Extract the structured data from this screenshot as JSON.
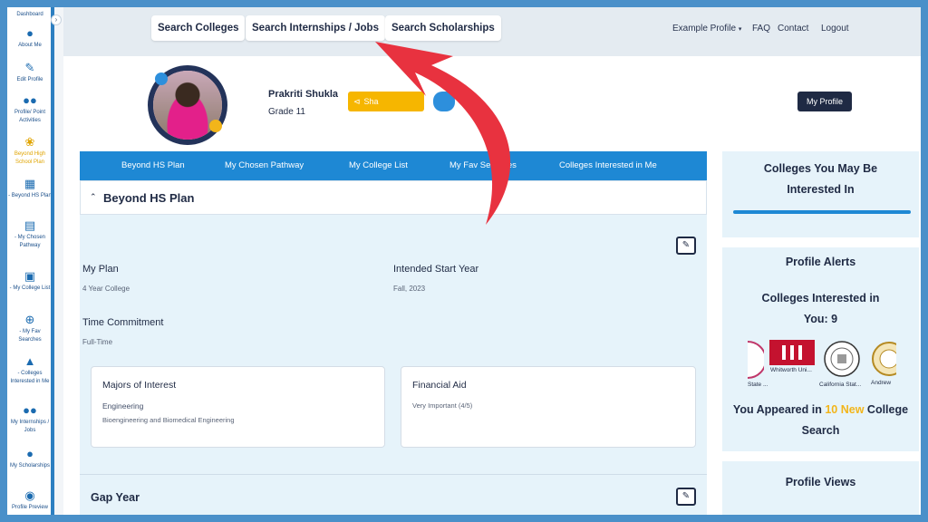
{
  "sidebar": {
    "items": [
      {
        "label": "Dashboard",
        "icon": "dashboard-icon"
      },
      {
        "label": "About Me",
        "icon": "user-icon"
      },
      {
        "label": "Edit Profile",
        "icon": "edit-icon"
      },
      {
        "label": "Profile/ Point Activities",
        "icon": "users-icon"
      },
      {
        "label": "Beyond High School Plan",
        "icon": "feather-icon"
      },
      {
        "label": "- Beyond HS Plan",
        "icon": "document-icon"
      },
      {
        "label": "- My Chosen Pathway",
        "icon": "map-icon"
      },
      {
        "label": "- My College List",
        "icon": "building-icon"
      },
      {
        "label": "- My Fav Searches",
        "icon": "search-plus-icon"
      },
      {
        "label": "- Colleges Interested in Me",
        "icon": "graduation-cap-icon"
      },
      {
        "label": "My Internships / Jobs",
        "icon": "users-icon"
      },
      {
        "label": "My Scholarships",
        "icon": "user-icon"
      },
      {
        "label": "Profile Preview",
        "icon": "eye-icon"
      }
    ]
  },
  "topbar": {
    "search_colleges": "Search Colleges",
    "search_internships": "Search Internships / Jobs",
    "search_scholarships": "Search Scholarships",
    "example_profile": "Example Profile",
    "faq": "FAQ",
    "contact": "Contact",
    "logout": "Logout"
  },
  "profile": {
    "name": "Prakriti Shukla",
    "grade": "Grade 11",
    "share_label": "Sha",
    "my_profile": "My Profile"
  },
  "tabs": [
    "Beyond HS Plan",
    "My Chosen Pathway",
    "My College List",
    "My Fav Searches",
    "Colleges Interested in Me"
  ],
  "beyond_hs_plan": {
    "title": "Beyond HS Plan",
    "my_plan_label": "My Plan",
    "my_plan_value": "4 Year College",
    "start_year_label": "Intended Start Year",
    "start_year_value": "Fall, 2023",
    "time_commitment_label": "Time Commitment",
    "time_commitment_value": "Full-Time",
    "majors_title": "Majors of Interest",
    "majors_category": "Engineering",
    "majors_detail": "Bioengineering and Biomedical Engineering",
    "financial_aid_title": "Financial Aid",
    "financial_aid_value": "Very Important (4/5)"
  },
  "gap_year": {
    "title": "Gap Year"
  },
  "right_column": {
    "colleges_may_be_interested_line1": "Colleges You May Be",
    "colleges_may_be_interested_line2": "Interested In",
    "profile_alerts_title": "Profile Alerts",
    "colleges_interested_line1": "Colleges Interested in",
    "colleges_interested_line2": "You: 9",
    "logo_captions": [
      "State ...",
      "Whitworth Uni...",
      "California Stat...",
      "Andrew"
    ],
    "appeared_prefix": "You Appeared in",
    "appeared_highlight": "10 New",
    "appeared_suffix": "College",
    "appeared_line2": "Search",
    "profile_views_title": "Profile Views"
  },
  "colors": {
    "accent_blue": "#1e88d4",
    "navy": "#1f2a44",
    "yellow": "#f2b51a",
    "arrow_red": "#e8323f"
  }
}
